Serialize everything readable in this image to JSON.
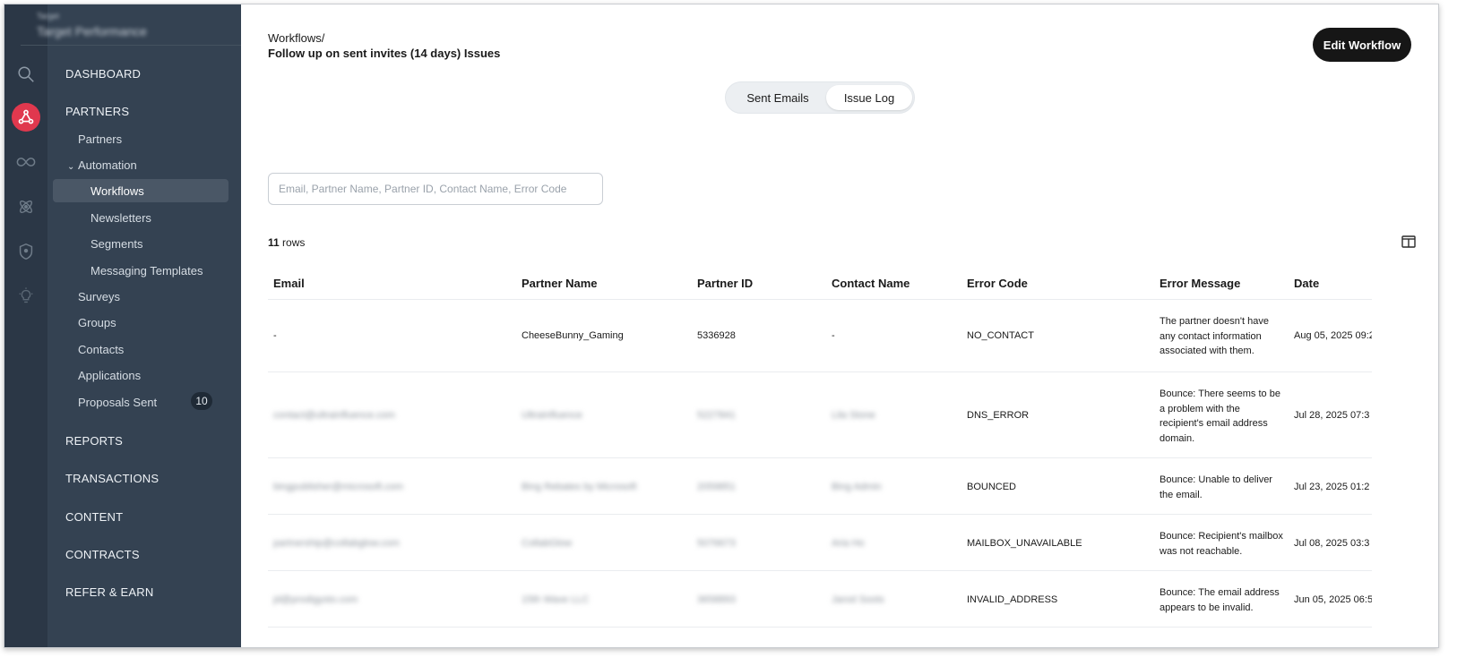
{
  "brand": {
    "small": "Target",
    "name": "Target Performance"
  },
  "nav": {
    "sections": {
      "dashboard": "DASHBOARD",
      "partners": "PARTNERS",
      "reports": "REPORTS",
      "transactions": "TRANSACTIONS",
      "content": "CONTENT",
      "contracts": "CONTRACTS",
      "refer": "REFER & EARN"
    },
    "items": {
      "partners": "Partners",
      "automation": "Automation",
      "workflows": "Workflows",
      "newsletters": "Newsletters",
      "segments": "Segments",
      "messaging_templates": "Messaging Templates",
      "surveys": "Surveys",
      "groups": "Groups",
      "contacts": "Contacts",
      "applications": "Applications",
      "proposals_sent": "Proposals Sent"
    },
    "proposals_badge": "10"
  },
  "header": {
    "breadcrumb_root": "Workflows/",
    "title": "Follow up on sent invites (14 days) Issues",
    "edit_button": "Edit Workflow"
  },
  "tabs": {
    "sent_emails": "Sent Emails",
    "issue_log": "Issue Log"
  },
  "search": {
    "placeholder": "Email, Partner Name, Partner ID, Contact Name, Error Code",
    "value": ""
  },
  "table": {
    "row_count": "11",
    "row_count_suffix": " rows",
    "columns": [
      "Email",
      "Partner Name",
      "Partner ID",
      "Contact Name",
      "Error Code",
      "Error Message",
      "Date"
    ],
    "rows": [
      {
        "email": "-",
        "partner_name": "CheeseBunny_Gaming",
        "partner_id": "5336928",
        "contact_name": "-",
        "error_code": "NO_CONTACT",
        "error_message": "The partner doesn't have any contact information associated with them.",
        "date": "Aug 05, 2025 09:2"
      },
      {
        "email": "contact@ultrainfluence.com",
        "partner_name": "UltraInfluence",
        "partner_id": "5227841",
        "contact_name": "Lila Stone",
        "error_code": "DNS_ERROR",
        "error_message": "Bounce: There seems to be a problem with the recipient's email address domain.",
        "date": "Jul 28, 2025 07:3"
      },
      {
        "email": "bingpublisher@microsoft.com",
        "partner_name": "Bing Rebates by Microsoft",
        "partner_id": "2059851",
        "contact_name": "Bing Admin",
        "error_code": "BOUNCED",
        "error_message": "Bounce: Unable to deliver the email.",
        "date": "Jul 23, 2025 01:2"
      },
      {
        "email": "partnership@collabglow.com",
        "partner_name": "CollabGlow",
        "partner_id": "5076673",
        "contact_name": "Aria Ho",
        "error_code": "MAILBOX_UNAVAILABLE",
        "error_message": "Bounce: Recipient's mailbox was not reachable.",
        "date": "Jul 08, 2025 03:3"
      },
      {
        "email": "jd@prodigysto.com",
        "partner_name": "15th Wave LLC",
        "partner_id": "3658893",
        "contact_name": "Jarod Soots",
        "error_code": "INVALID_ADDRESS",
        "error_message": "Bounce: The email address appears to be invalid.",
        "date": "Jun 05, 2025 06:5"
      }
    ]
  },
  "colors": {
    "rail_bg": "#2b3746",
    "nav_bg": "#344252",
    "accent": "#e0384e",
    "button_bg": "#161616"
  }
}
